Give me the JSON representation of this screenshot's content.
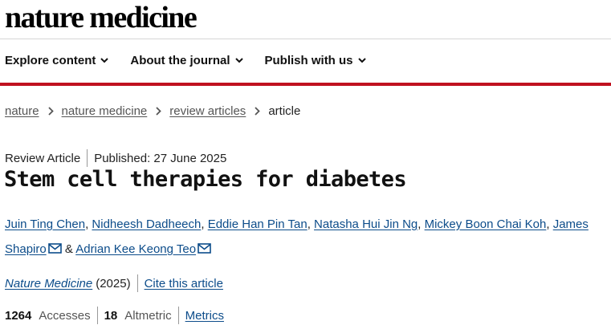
{
  "site": {
    "logo_text": "nature medicine"
  },
  "nav": {
    "items": [
      {
        "label": "Explore content"
      },
      {
        "label": "About the journal"
      },
      {
        "label": "Publish with us"
      }
    ]
  },
  "breadcrumb": {
    "items": [
      "nature",
      "nature medicine",
      "review articles"
    ],
    "current": "article"
  },
  "article": {
    "type": "Review Article",
    "published": "Published: 27 June 2025",
    "title": "Stem cell therapies for diabetes",
    "authors": [
      "Juin Ting Chen",
      "Nidheesh Dadheech",
      "Eddie Han Pin Tan",
      "Natasha Hui Jin Ng",
      "Mickey Boon Chai Koh",
      "James Shapiro",
      "Adrian Kee Keong Teo"
    ],
    "separators": {
      "comma": ", ",
      "and": " & "
    },
    "journal": "Nature Medicine",
    "year": "(2025)",
    "cite_label": "Cite this article"
  },
  "metrics": {
    "accesses_count": "1264",
    "accesses_label": "Accesses",
    "altmetric_count": "18",
    "altmetric_label": "Altmetric",
    "metrics_link": "Metrics"
  },
  "colors": {
    "accent": "#c0111f",
    "link": "#0c4c8a"
  },
  "icons": {
    "nav_chevron": "chevron-down-icon",
    "crumb_sep": "chevron-right-icon",
    "mail": "mail-icon"
  }
}
